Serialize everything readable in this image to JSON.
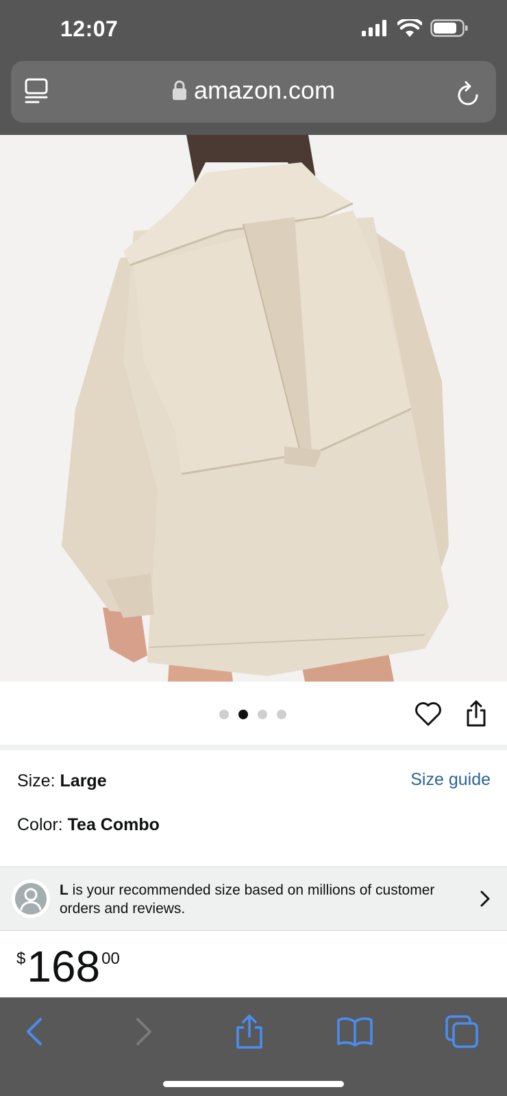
{
  "status_bar": {
    "time": "12:07"
  },
  "browser": {
    "url": "amazon.com",
    "icons": [
      "reader-icon",
      "lock-icon",
      "reload-icon"
    ]
  },
  "product_image": {
    "carousel_dots": 4,
    "active_index": 1
  },
  "product": {
    "size_label": "Size: ",
    "size_value": "Large",
    "size_guide_link": "Size guide",
    "color_label": "Color: ",
    "color_value": "Tea Combo",
    "recommendation_bold": "L",
    "recommendation_text": " is your recommended size based on millions of customer orders and reviews.",
    "price_symbol": "$",
    "price_whole": "168",
    "price_fraction": "00"
  },
  "toolbar": {
    "icons": [
      "back-icon",
      "forward-icon",
      "share-icon",
      "bookmarks-icon",
      "tabs-icon"
    ]
  },
  "colors": {
    "link": "#2a6496",
    "safari_blue": "#3b82f6",
    "chrome_gray": "#565656"
  }
}
